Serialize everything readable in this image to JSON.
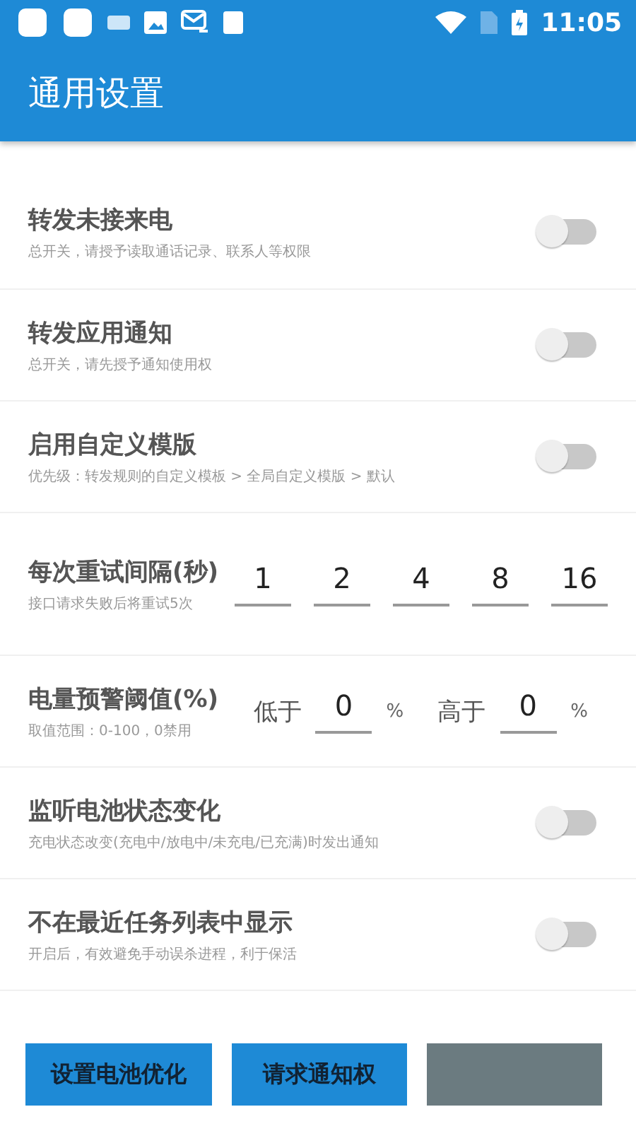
{
  "status_bar": {
    "time": "11:05"
  },
  "app_bar": {
    "title": "通用设置"
  },
  "settings": [
    {
      "kind": "switch",
      "title": "转发未接来电",
      "subtitle": "总开关，请授予读取通话记录、联系人等权限",
      "on": false
    },
    {
      "kind": "switch",
      "title": "转发应用通知",
      "subtitle": "总开关，请先授予通知使用权",
      "on": false
    },
    {
      "kind": "switch",
      "title": "启用自定义模版",
      "subtitle": "优先级：转发规则的自定义模板 > 全局自定义模版 > 默认",
      "on": false
    },
    {
      "kind": "retry",
      "title": "每次重试间隔(秒)",
      "subtitle": "接口请求失败后将重试5次",
      "values": [
        "1",
        "2",
        "4",
        "8",
        "16"
      ]
    },
    {
      "kind": "threshold",
      "title": "电量预警阈值(%)",
      "subtitle": "取值范围：0-100，0禁用",
      "fields": [
        {
          "label": "低于",
          "value": "0",
          "unit": "%"
        },
        {
          "label": "高于",
          "value": "0",
          "unit": "%"
        }
      ]
    },
    {
      "kind": "switch",
      "title": "监听电池状态变化",
      "subtitle": "充电状态改变(充电中/放电中/未充电/已充满)时发出通知",
      "on": false
    },
    {
      "kind": "switch",
      "title": "不在最近任务列表中显示",
      "subtitle": "开启后，有效避免手动误杀进程，利于保活",
      "on": false
    }
  ],
  "buttons": [
    {
      "label": "设置电池优化",
      "disabled": false
    },
    {
      "label": "请求通知权",
      "disabled": false
    },
    {
      "disabled": true
    }
  ]
}
